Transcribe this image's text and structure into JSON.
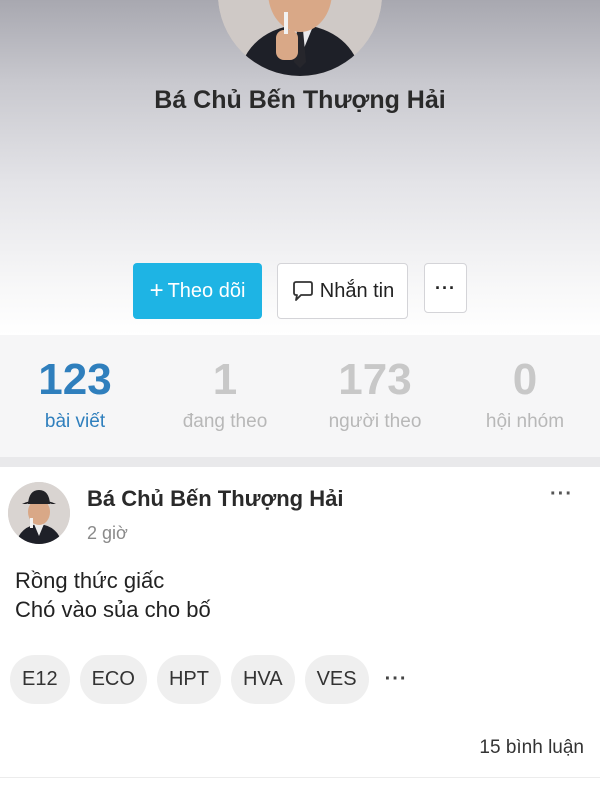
{
  "profile": {
    "name": "Bá Chủ Bến Thượng Hải",
    "avatar_icon": "profile-photo"
  },
  "actions": {
    "follow_label": "Theo dõi",
    "message_label": "Nhắn tin",
    "more_label": "···"
  },
  "stats": [
    {
      "value": "123",
      "label": "bài viết",
      "active": true
    },
    {
      "value": "1",
      "label": "đang theo",
      "active": false
    },
    {
      "value": "173",
      "label": "người theo",
      "active": false
    },
    {
      "value": "0",
      "label": "hội nhóm",
      "active": false
    }
  ],
  "post": {
    "author": "Bá Chủ Bến Thượng Hải",
    "time": "2 giờ",
    "more_label": "···",
    "lines": [
      "Rồng thức giấc",
      "Chó vào sủa cho bố"
    ],
    "tags": [
      "E12",
      "ECO",
      "HPT",
      "HVA",
      "VES"
    ],
    "tags_more_label": "···",
    "comments": "15 bình luận"
  },
  "colors": {
    "accent": "#1eb4e4",
    "active_stat": "#2f7fbd",
    "muted_stat": "#c8c8c8"
  }
}
